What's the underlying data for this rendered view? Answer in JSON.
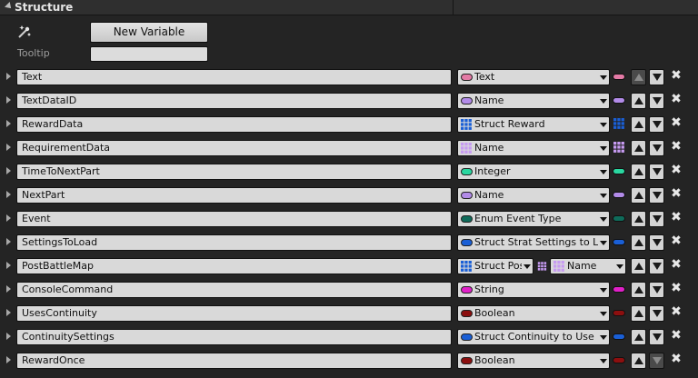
{
  "panel": {
    "title": "Structure",
    "new_variable_label": "New Variable",
    "tooltip_label": "Tooltip",
    "tooltip_value": ""
  },
  "colors": {
    "text": "#e37aa5",
    "name": "#b28be8",
    "struct": "#1a5fd6",
    "integer": "#2ad7a0",
    "enum": "#0f6b5a",
    "string": "#e020c8",
    "boolean": "#8c0f0f",
    "name_grid": "#c79bf2"
  },
  "variables": [
    {
      "name": "Text",
      "type": "Text",
      "icon": "text-pill-icon",
      "kind": "pill",
      "color": "#e37aa5",
      "up_enabled": false,
      "down_enabled": true
    },
    {
      "name": "TextDataID",
      "type": "Name",
      "icon": "name-pill-icon",
      "kind": "pill",
      "color": "#b28be8",
      "up_enabled": true,
      "down_enabled": true
    },
    {
      "name": "RewardData",
      "type": "Struct Reward",
      "icon": "struct-grid-icon",
      "kind": "grid",
      "color": "#1a5fd6",
      "up_enabled": true,
      "down_enabled": true
    },
    {
      "name": "RequirementData",
      "type": "Name",
      "icon": "name-grid-icon",
      "kind": "grid",
      "color": "#c79bf2",
      "up_enabled": true,
      "down_enabled": true
    },
    {
      "name": "TimeToNextPart",
      "type": "Integer",
      "icon": "integer-pill-icon",
      "kind": "pill",
      "color": "#2ad7a0",
      "up_enabled": true,
      "down_enabled": true
    },
    {
      "name": "NextPart",
      "type": "Name",
      "icon": "name-pill-icon",
      "kind": "pill",
      "color": "#b28be8",
      "up_enabled": true,
      "down_enabled": true
    },
    {
      "name": "Event",
      "type": "Enum Event Type",
      "icon": "enum-pill-icon",
      "kind": "pill",
      "color": "#0f6b5a",
      "up_enabled": true,
      "down_enabled": true
    },
    {
      "name": "SettingsToLoad",
      "type": "Struct Strat Settings to Loa",
      "icon": "struct-pill-icon",
      "kind": "pill",
      "color": "#1a5fd6",
      "up_enabled": true,
      "down_enabled": true
    },
    {
      "name": "PostBattleMap",
      "type": "Struct Pos",
      "value_type": "Name",
      "icon": "map-icon",
      "kind": "map",
      "color": "#1a5fd6",
      "up_enabled": true,
      "down_enabled": true
    },
    {
      "name": "ConsoleCommand",
      "type": "String",
      "icon": "string-pill-icon",
      "kind": "pill",
      "color": "#e020c8",
      "up_enabled": true,
      "down_enabled": true
    },
    {
      "name": "UsesContinuity",
      "type": "Boolean",
      "icon": "boolean-pill-icon",
      "kind": "pill",
      "color": "#8c0f0f",
      "up_enabled": true,
      "down_enabled": true
    },
    {
      "name": "ContinuitySettings",
      "type": "Struct Continuity to Use",
      "icon": "struct-pill-icon",
      "kind": "pill",
      "color": "#1a5fd6",
      "up_enabled": true,
      "down_enabled": true
    },
    {
      "name": "RewardOnce",
      "type": "Boolean",
      "icon": "boolean-pill-icon",
      "kind": "pill",
      "color": "#8c0f0f",
      "up_enabled": true,
      "down_enabled": false
    }
  ]
}
